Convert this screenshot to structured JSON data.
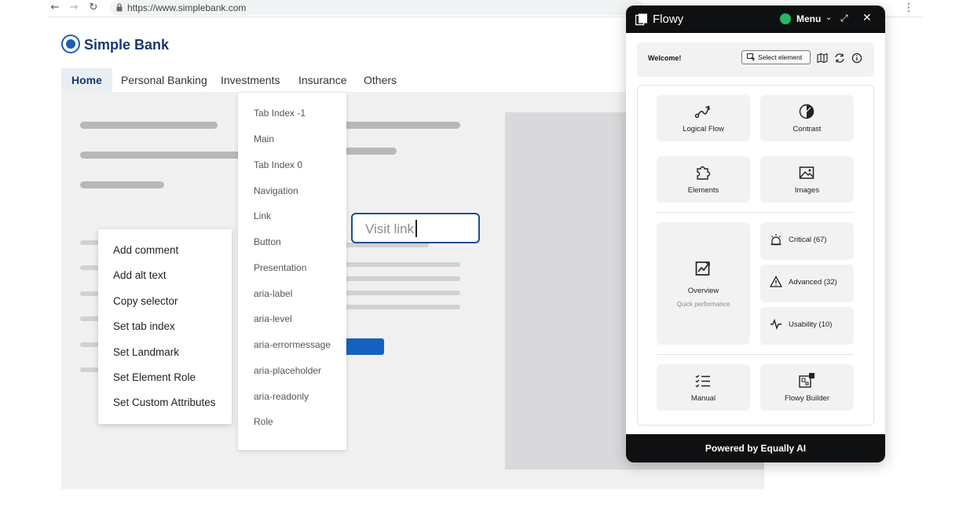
{
  "browser": {
    "back_icon": "arrow-left-icon",
    "forward_icon": "arrow-right-icon",
    "reload_icon": "reload-icon",
    "url": "https://www.simplebank.com"
  },
  "site": {
    "brand": "Simple Bank",
    "brand_color": "#1c5fb3",
    "nav": [
      "Home",
      "Personal Banking",
      "Investments",
      "Insurance",
      "Others"
    ],
    "active_nav": "Home",
    "visit_input_placeholder": "Visit link"
  },
  "context_menu": {
    "items": [
      "Add comment",
      "Add alt text",
      "Copy selector",
      "Set tab index",
      "Set Landmark",
      "Set Element Role",
      "Set Custom Attributes"
    ]
  },
  "role_menu": {
    "items": [
      "Tab Index -1",
      "Main",
      "Tab Index 0",
      "Navigation",
      "Link",
      "Button",
      "Presentation",
      "aria-label",
      "aria-level",
      "aria-errormessage",
      "aria-placeholder",
      "aria-readonly",
      "Role"
    ]
  },
  "flowy": {
    "title": "Flowy",
    "status_color": "#25b865",
    "menu_label": "Menu",
    "welcome": "Welcome!",
    "select_element": "Select element",
    "tiles": {
      "logical_flow": "Logical Flow",
      "contrast": "Contrast",
      "elements": "Elements",
      "images": "Images",
      "overview": "Overview",
      "overview_sub": "Quick performance",
      "critical": "Critical (67)",
      "advanced": "Advanced (32)",
      "usability": "Usability (10)",
      "manual": "Manual",
      "flowy_builder": "Flowy Builder"
    },
    "footer": "Powered by Equally AI"
  }
}
